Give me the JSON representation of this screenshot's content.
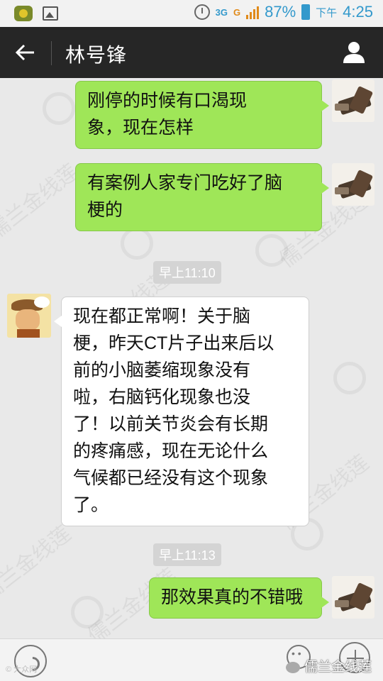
{
  "status_bar": {
    "battery_percent": "87%",
    "ampm": "下午",
    "time": "4:25",
    "net_label_1": "3G",
    "net_label_2": "G"
  },
  "header": {
    "title": "林号锋"
  },
  "messages": [
    {
      "side": "me",
      "text": "刚停的时候有口渴现象，现在怎样",
      "lines": [
        "刚停的时候有口渴现",
        "象，现在怎样"
      ]
    },
    {
      "side": "me",
      "text": "有案例人家专门吃好了脑梗的",
      "lines": [
        "有案例人家专门吃好了脑",
        "梗的"
      ]
    },
    {
      "type": "timestamp",
      "text": "早上11:10"
    },
    {
      "side": "them",
      "text": "现在都正常啊！关于脑梗，昨天CT片子出来后以前的小脑萎缩现象没有啦，右脑钙化现象也没了！以前关节炎会有长期的疼痛感，现在无论什么气候都已经没有这个现象了。",
      "lines": [
        "现在都正常啊！关于脑",
        "梗，昨天CT片子出来后以",
        "前的小脑萎缩现象没有",
        "啦，右脑钙化现象也没",
        "了！以前关节炎会有长期",
        "的疼痛感，现在无论什么",
        "气候都已经没有这个现象",
        "了。"
      ]
    },
    {
      "type": "timestamp",
      "text": "早上11:13"
    },
    {
      "side": "me",
      "text": "那效果真的不错哦",
      "lines": [
        "那效果真的不错哦"
      ]
    }
  ],
  "watermark": {
    "text": "儒兰金线莲"
  },
  "bottom_bar": {
    "copyright": "© 大众网",
    "watermark_text": "儒兰金线莲"
  },
  "icons": {
    "back": "arrow-left-icon",
    "contact": "person-icon",
    "voice": "voice-icon",
    "emoji": "emoji-icon",
    "more": "plus-icon"
  },
  "colors": {
    "appbar": "#262626",
    "my_bubble": "#9fe658",
    "their_bubble": "#ffffff",
    "chat_bg": "#e9e9e9"
  }
}
